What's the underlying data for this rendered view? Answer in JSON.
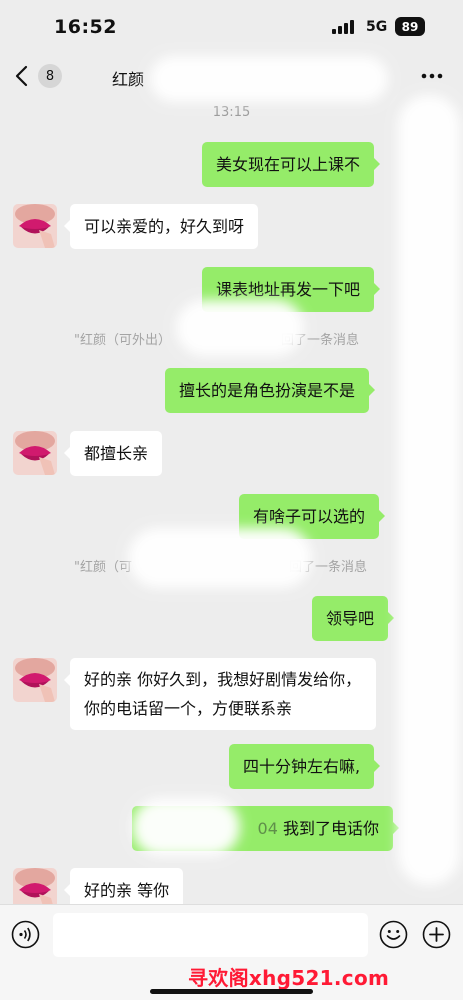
{
  "status_bar": {
    "time": "16:52",
    "network": "5G",
    "battery": "89"
  },
  "header": {
    "back_badge": "8",
    "title": "红颜"
  },
  "timestamp": "13:15",
  "messages": {
    "m1": "美女现在可以上课不",
    "m2": "可以亲爱的，好久到呀",
    "m3": "课表地址再发一下吧",
    "m4": "擅长的是角色扮演是不是",
    "m5": "都擅长亲",
    "m6": "有啥子可以选的",
    "m7": "领导吧",
    "m8": "好的亲 你好久到，我想好剧情发给你，你的电话留一个，方便联系亲",
    "m9": "四十分钟左右嘛,",
    "m10_prefix": "04",
    "m10": "我到了电话你",
    "m11": "好的亲 等你"
  },
  "notices": {
    "n1_start": "\"红颜（可外出）",
    "n1_end": "回了一条消息",
    "n2_start": "\"红颜（可",
    "n2_end": "回了一条消息"
  },
  "watermark": "寻欢阁xhg521.com",
  "icons": [
    "back-chevron-icon",
    "more-icon",
    "voice-icon",
    "emoji-icon",
    "plus-icon"
  ],
  "colors": {
    "sent_bubble": "#95ec69",
    "received_bubble": "#ffffff",
    "background": "#ededed",
    "watermark": "#ff1a35"
  }
}
